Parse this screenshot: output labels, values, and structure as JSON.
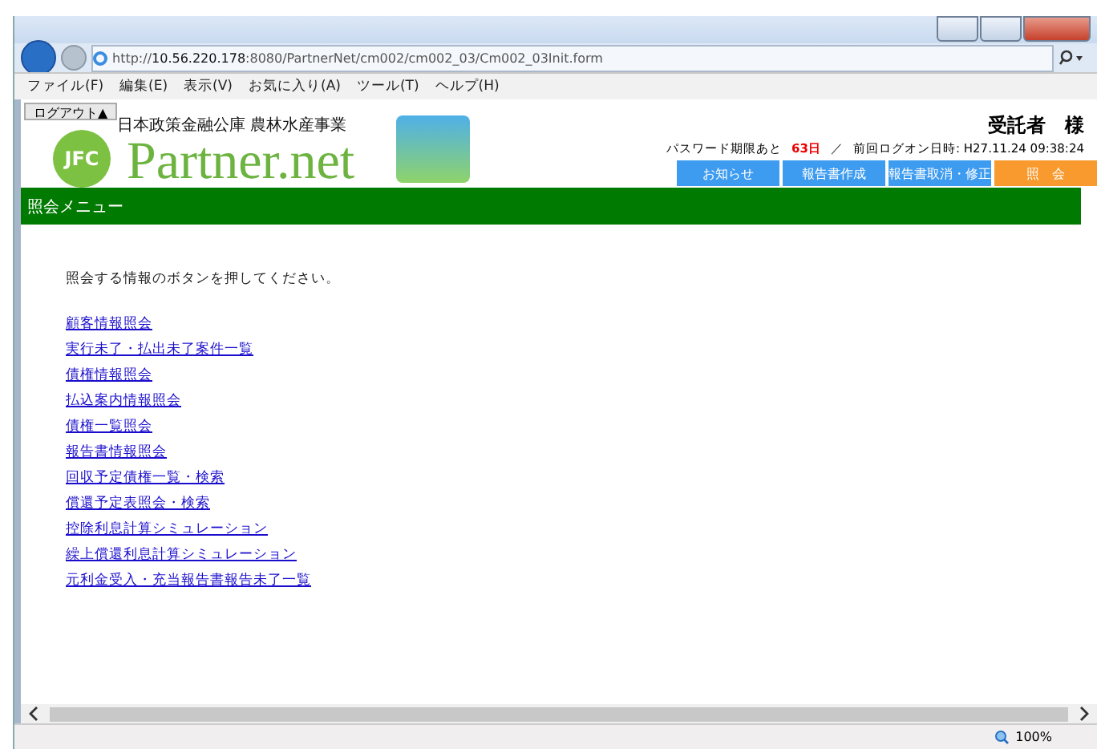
{
  "browser": {
    "address": "http://**10.56.220.178**:8080/PartnerNet/cm002/cm002_03/Cm002_03Init.form",
    "menu": [
      "ファイル(F)",
      "編集(E)",
      "表示(V)",
      "お気に入り(A)",
      "ツール(T)",
      "ヘルプ(H)"
    ],
    "zoom": "100%"
  },
  "header": {
    "logout": "ログアウト▲",
    "logo_mark": "JFC",
    "organization": "日本政策金融公庫 農林水産事業",
    "product": "Partner.net",
    "user": "受託者　様",
    "password_label": "パスワード期限あと",
    "password_days": "63日",
    "separator": "／",
    "last_logon": "前回ログオン日時: H27.11.24 09:38:24",
    "nav": [
      {
        "label": "お知らせ",
        "selected": false
      },
      {
        "label": "報告書作成",
        "selected": false
      },
      {
        "label": "報告書取消・修正",
        "selected": false
      },
      {
        "label": "照　会",
        "selected": true
      }
    ]
  },
  "section_title": "照会メニュー",
  "instruction": "照会する情報のボタンを押してください。",
  "links": [
    "顧客情報照会",
    "実行未了・払出未了案件一覧",
    "債権情報照会",
    "払込案内情報照会",
    "債権一覧照会",
    "報告書情報照会",
    "回収予定債権一覧・検索",
    "償還予定表照会・検索",
    "控除利息計算シミュレーション",
    "繰上償還利息計算シミュレーション",
    "元利金受入・充当報告書報告未了一覧"
  ]
}
